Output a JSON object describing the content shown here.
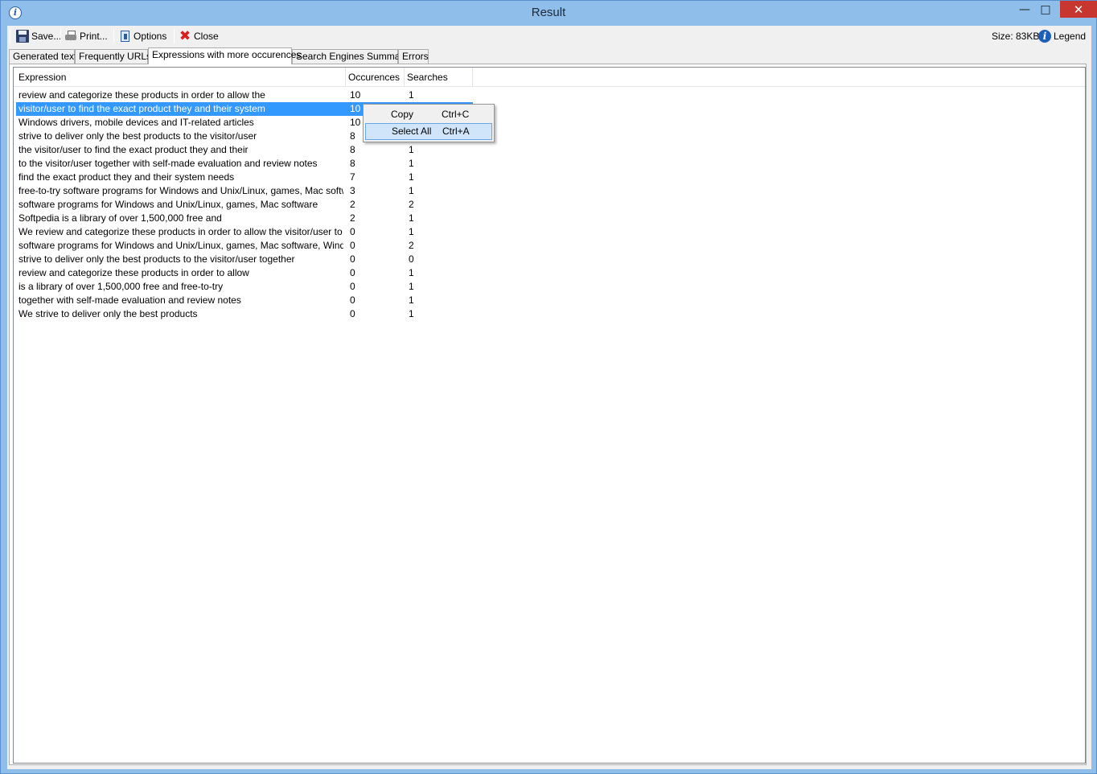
{
  "window": {
    "title": "Result"
  },
  "toolbar": {
    "save": "Save...",
    "print": "Print...",
    "options": "Options",
    "close": "Close",
    "size": "Size: 83KB",
    "legend": "Legend"
  },
  "tabs": [
    {
      "label": "Generated text"
    },
    {
      "label": "Frequently URLs"
    },
    {
      "label": "Expressions with more occurences"
    },
    {
      "label": "Search Engines Summary"
    },
    {
      "label": "Errors"
    }
  ],
  "active_tab": "Expressions with more occurences",
  "table": {
    "columns": [
      "Expression",
      "Occurences",
      "Searches"
    ],
    "rows": [
      {
        "expression": "review and categorize these products in order to allow the",
        "occurences": "10",
        "searches": "1"
      },
      {
        "expression": "visitor/user to find the exact product they and their system",
        "occurences": "10",
        "searches": ""
      },
      {
        "expression": "Windows drivers, mobile devices and IT-related articles",
        "occurences": "10",
        "searches": ""
      },
      {
        "expression": "strive to deliver only the best products to the visitor/user",
        "occurences": "8",
        "searches": ""
      },
      {
        "expression": "the visitor/user to find the exact product they and their",
        "occurences": "8",
        "searches": "1"
      },
      {
        "expression": "to the visitor/user together with self-made evaluation and review notes",
        "occurences": "8",
        "searches": "1"
      },
      {
        "expression": "find the exact product they and their system needs",
        "occurences": "7",
        "searches": "1"
      },
      {
        "expression": "free-to-try software programs for Windows and Unix/Linux, games, Mac software",
        "occurences": "3",
        "searches": "1"
      },
      {
        "expression": "software programs for Windows and Unix/Linux, games, Mac software",
        "occurences": "2",
        "searches": "2"
      },
      {
        "expression": "Softpedia is a library of over 1,500,000 free and",
        "occurences": "2",
        "searches": "1"
      },
      {
        "expression": "We review and categorize these products in order to allow the visitor/user to",
        "occurences": "0",
        "searches": "1"
      },
      {
        "expression": "software programs for Windows and Unix/Linux, games, Mac software, Windows dri...",
        "occurences": "0",
        "searches": "2"
      },
      {
        "expression": "strive to deliver only the best products to the visitor/user together",
        "occurences": "0",
        "searches": "0"
      },
      {
        "expression": "review and categorize these products in order to allow",
        "occurences": "0",
        "searches": "1"
      },
      {
        "expression": "is a library of over 1,500,000 free and free-to-try",
        "occurences": "0",
        "searches": "1"
      },
      {
        "expression": "together with self-made evaluation and review notes",
        "occurences": "0",
        "searches": "1"
      },
      {
        "expression": "We strive to deliver only the best products",
        "occurences": "0",
        "searches": "1"
      }
    ],
    "selected_row": 1
  },
  "context_menu": {
    "items": [
      {
        "label": "Copy",
        "shortcut": "Ctrl+C"
      },
      {
        "label": "Select All",
        "shortcut": "Ctrl+A"
      }
    ],
    "highlighted": "Select All"
  },
  "icons": {
    "app": "info-icon",
    "save": "floppy-disk-icon",
    "print": "printer-icon",
    "options": "options-icon",
    "close": "red-x-icon",
    "legend": "info-icon"
  },
  "colors": {
    "title_bar": "#8ebee9",
    "close_button": "#c7372f",
    "selection": "#3399ff",
    "menu_highlight": "#d1e5fa"
  }
}
